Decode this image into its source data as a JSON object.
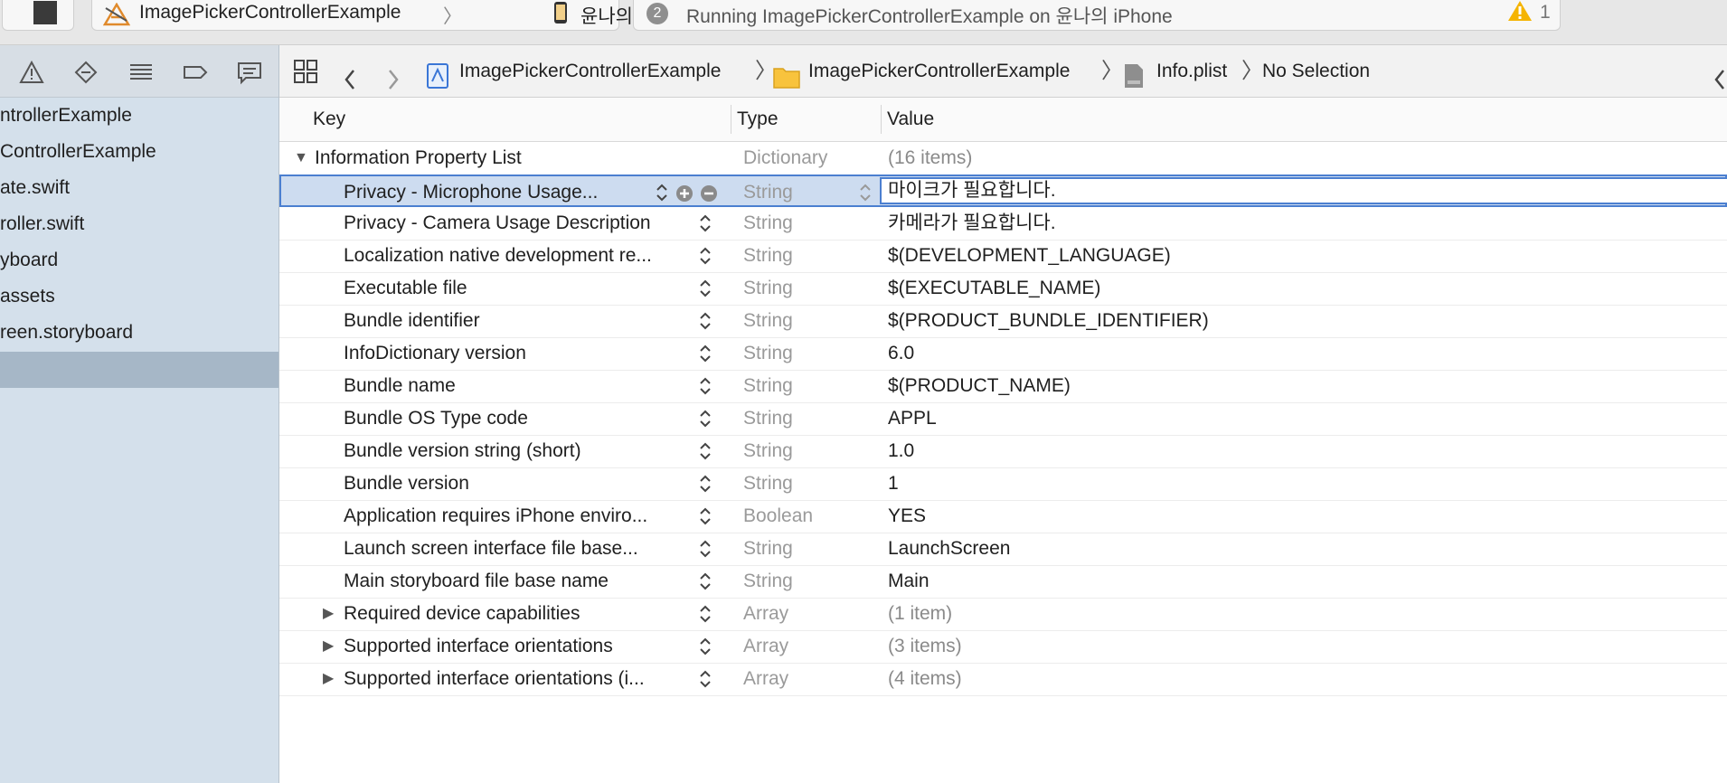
{
  "toolbar": {
    "scheme_name": "ImagePickerControllerExample",
    "device_name": "윤나의 iPhone",
    "activity_count": "2",
    "activity_text": "Running ImagePickerControllerExample on 윤나의 iPhone",
    "warning_count": "1",
    "colors": {
      "warning": "#f5b400",
      "accent": "#4b7fd0"
    }
  },
  "navigator": {
    "tab_icons": [
      "warning-icon",
      "breakpoint-diamond-icon",
      "list-icon",
      "label-tag-icon",
      "comment-icon"
    ],
    "items": [
      "ntrollerExample",
      "ControllerExample",
      "ate.swift",
      "roller.swift",
      "yboard",
      "assets",
      "reen.storyboard",
      ""
    ]
  },
  "jumpbar": {
    "project": "ImagePickerControllerExample",
    "folder": "ImagePickerControllerExample",
    "file": "Info.plist",
    "selection": "No Selection",
    "separator": "〉"
  },
  "columns": {
    "key": "Key",
    "type": "Type",
    "value": "Value"
  },
  "root": {
    "key": "Information Property List",
    "type": "Dictionary",
    "value": "(16 items)"
  },
  "rows": [
    {
      "key": "Privacy - Microphone Usage...",
      "type": "String",
      "value": "마이크가 필요합니다."
    },
    {
      "key": "Privacy - Camera Usage Description",
      "type": "String",
      "value": "카메라가 필요합니다."
    },
    {
      "key": "Localization native development re...",
      "type": "String",
      "value": "$(DEVELOPMENT_LANGUAGE)"
    },
    {
      "key": "Executable file",
      "type": "String",
      "value": "$(EXECUTABLE_NAME)"
    },
    {
      "key": "Bundle identifier",
      "type": "String",
      "value": "$(PRODUCT_BUNDLE_IDENTIFIER)"
    },
    {
      "key": "InfoDictionary version",
      "type": "String",
      "value": "6.0"
    },
    {
      "key": "Bundle name",
      "type": "String",
      "value": "$(PRODUCT_NAME)"
    },
    {
      "key": "Bundle OS Type code",
      "type": "String",
      "value": "APPL"
    },
    {
      "key": "Bundle version string (short)",
      "type": "String",
      "value": "1.0"
    },
    {
      "key": "Bundle version",
      "type": "String",
      "value": "1"
    },
    {
      "key": "Application requires iPhone enviro...",
      "type": "Boolean",
      "value": "YES"
    },
    {
      "key": "Launch screen interface file base...",
      "type": "String",
      "value": "LaunchScreen"
    },
    {
      "key": "Main storyboard file base name",
      "type": "String",
      "value": "Main"
    },
    {
      "key": "Required device capabilities",
      "type": "Array",
      "value": "(1 item)"
    },
    {
      "key": "Supported interface orientations",
      "type": "Array",
      "value": "(3 items)"
    },
    {
      "key": "Supported interface orientations (i...",
      "type": "Array",
      "value": "(4 items)"
    }
  ]
}
